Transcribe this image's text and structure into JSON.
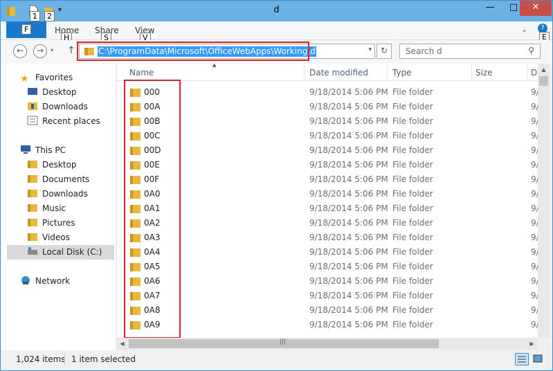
{
  "window": {
    "title": "d",
    "minimize_glyph": "—",
    "maximize_glyph": "□",
    "close_glyph": "✕"
  },
  "keytips": {
    "qa1": "1",
    "qa2": "2",
    "file": "F",
    "home": "H",
    "share": "S",
    "view": "V",
    "expand": "E"
  },
  "ribbon": {
    "tabs": [
      "Home",
      "Share",
      "View"
    ]
  },
  "address": {
    "path": "C:\\ProgramData\\Microsoft\\OfficeWebApps\\Working\\d"
  },
  "search": {
    "placeholder": "Search d"
  },
  "nav": {
    "favorites": {
      "label": "Favorites",
      "items": [
        "Desktop",
        "Downloads",
        "Recent places"
      ]
    },
    "this_pc": {
      "label": "This PC",
      "items": [
        "Desktop",
        "Documents",
        "Downloads",
        "Music",
        "Pictures",
        "Videos",
        "Local Disk (C:)"
      ]
    },
    "network": {
      "label": "Network"
    }
  },
  "columns": {
    "name": "Name",
    "date": "Date modified",
    "type": "Type",
    "size": "Size",
    "extra": "D"
  },
  "files": [
    {
      "name": "000",
      "date": "9/18/2014 5:06 PM",
      "type": "File folder",
      "extra": "9/"
    },
    {
      "name": "00A",
      "date": "9/18/2014 5:06 PM",
      "type": "File folder",
      "extra": "9/"
    },
    {
      "name": "00B",
      "date": "9/18/2014 5:06 PM",
      "type": "File folder",
      "extra": "9/"
    },
    {
      "name": "00C",
      "date": "9/18/2014 5:06 PM",
      "type": "File folder",
      "extra": "9/"
    },
    {
      "name": "00D",
      "date": "9/18/2014 5:06 PM",
      "type": "File folder",
      "extra": "9/"
    },
    {
      "name": "00E",
      "date": "9/18/2014 5:06 PM",
      "type": "File folder",
      "extra": "9/"
    },
    {
      "name": "00F",
      "date": "9/18/2014 5:06 PM",
      "type": "File folder",
      "extra": "9/"
    },
    {
      "name": "0A0",
      "date": "9/18/2014 5:06 PM",
      "type": "File folder",
      "extra": "9/"
    },
    {
      "name": "0A1",
      "date": "9/18/2014 5:06 PM",
      "type": "File folder",
      "extra": "9/"
    },
    {
      "name": "0A2",
      "date": "9/18/2014 5:06 PM",
      "type": "File folder",
      "extra": "9/"
    },
    {
      "name": "0A3",
      "date": "9/18/2014 5:06 PM",
      "type": "File folder",
      "extra": "9/"
    },
    {
      "name": "0A4",
      "date": "9/18/2014 5:06 PM",
      "type": "File folder",
      "extra": "9/"
    },
    {
      "name": "0A5",
      "date": "9/18/2014 5:06 PM",
      "type": "File folder",
      "extra": "9/"
    },
    {
      "name": "0A6",
      "date": "9/18/2014 5:06 PM",
      "type": "File folder",
      "extra": "9/"
    },
    {
      "name": "0A7",
      "date": "9/18/2014 5:06 PM",
      "type": "File folder",
      "extra": "9/"
    },
    {
      "name": "0A8",
      "date": "9/18/2014 5:06 PM",
      "type": "File folder",
      "extra": "9/"
    },
    {
      "name": "0A9",
      "date": "9/18/2014 5:06 PM",
      "type": "File folder",
      "extra": "9/"
    }
  ],
  "status": {
    "count": "1,024 items",
    "selection": "1 item selected"
  },
  "icons": {
    "folder": "folder-icon",
    "star": "star-icon",
    "computer": "computer-icon",
    "network": "network-icon",
    "search": "search-icon",
    "refresh": "refresh-icon"
  },
  "colors": {
    "titlebar": "#6cb1e3",
    "file_tab": "#1979ca",
    "selection": "#3399ff",
    "highlight_box": "#d2252a",
    "close": "#c7504b"
  }
}
